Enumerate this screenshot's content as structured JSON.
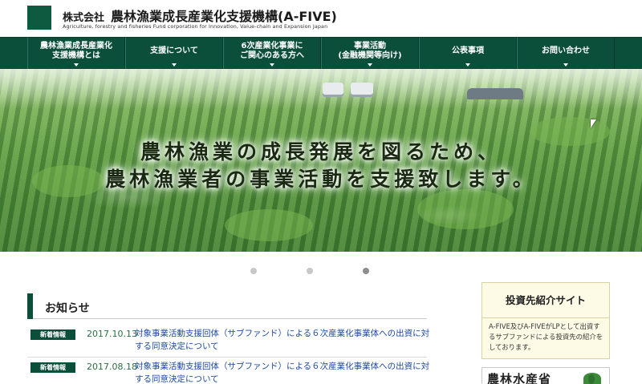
{
  "header": {
    "company_prefix": "株式会社",
    "company_name": "農林漁業成長産業化支援機構(A-FIVE)",
    "company_english": "Agriculture, forestry and fisheries Fund corporation for Innovation, Value-chain and Expansion Japan"
  },
  "nav": {
    "items": [
      {
        "line1": "農林漁業成長産業化",
        "line2": "支援機構とは"
      },
      {
        "line1": "支援について",
        "line2": ""
      },
      {
        "line1": "6次産業化事業に",
        "line2": "ご関心のある方へ"
      },
      {
        "line1": "事業活動",
        "line2": "(金融機関等向け)"
      },
      {
        "line1": "公表事項",
        "line2": ""
      },
      {
        "line1": "お問い合わせ",
        "line2": ""
      }
    ]
  },
  "hero": {
    "line1": "農林漁業の成長発展を図るため、",
    "line2": "農林漁業者の事業活動を支援致します。"
  },
  "slider": {
    "count": 3,
    "active_index": 3
  },
  "news": {
    "heading": "お知らせ",
    "items": [
      {
        "badge": "新着情報",
        "date": "2017.10.13",
        "text": "対象事業活動支援回体（サブファンド）による６次産業化事業体への出資に対する同意決定について"
      },
      {
        "badge": "新着情報",
        "date": "2017.08.18",
        "text": "対象事業活動支援回体（サブファンド）による６次産業化事業体への出資に対する同意決定について"
      }
    ]
  },
  "sidebar": {
    "investee_title": "投資先紹介サイト",
    "investee_desc": "A-FIVE及びA-FIVEがLPとして出資するサブファンドによる投資先の紹介をしております。",
    "maff_label": "農林水産省"
  },
  "colors": {
    "brand_green": "#0b4f3a",
    "link_blue": "#1d4aa3",
    "date_green": "#2c6f42",
    "sidebar_bg": "#fdfbe6"
  }
}
